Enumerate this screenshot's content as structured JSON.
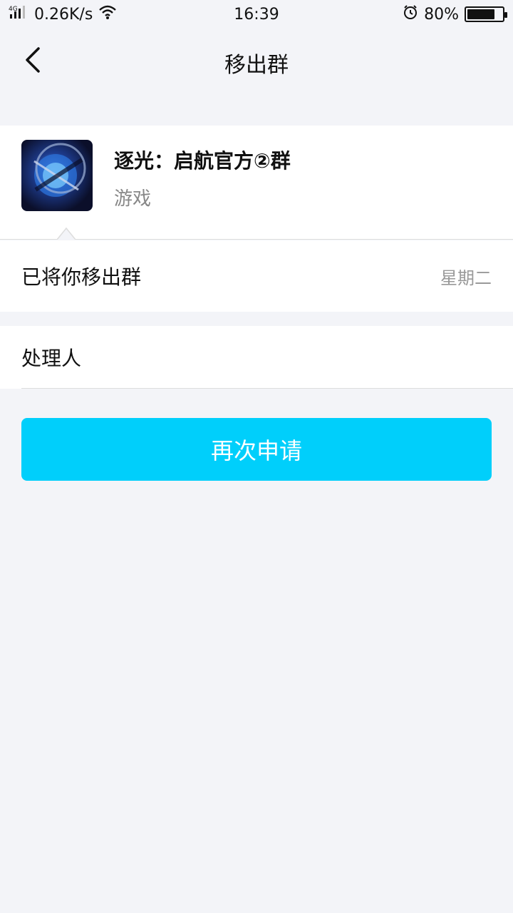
{
  "status_bar": {
    "network_label": "4G",
    "speed": "0.26K/s",
    "time": "16:39",
    "battery": "80%",
    "battery_level": 0.8
  },
  "header": {
    "title": "移出群",
    "back_icon": "chevron-left-icon"
  },
  "group": {
    "name": "逐光：启航官方②群",
    "type": "游戏",
    "avatar_icon": "group-avatar-image"
  },
  "message": {
    "text": "已将你移出群",
    "time": "星期二"
  },
  "handler": {
    "label": "处理人"
  },
  "actions": {
    "reapply_label": "再次申请",
    "reapply_color": "#00cffb"
  }
}
